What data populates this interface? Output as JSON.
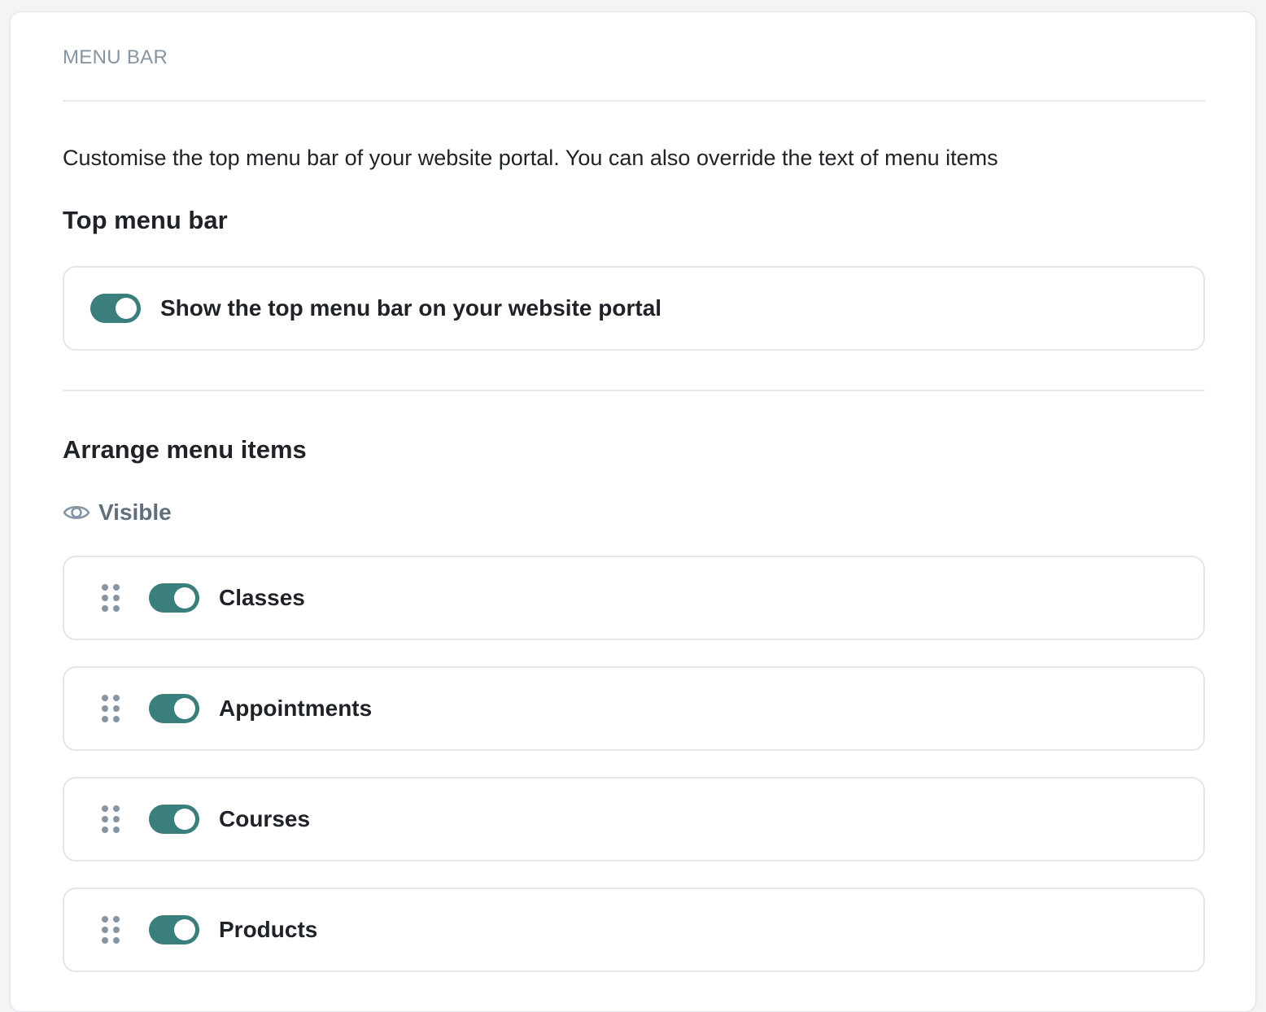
{
  "colors": {
    "accent": "#3a7f7b",
    "muted": "#8595a3",
    "visible_label": "#5f6f7c"
  },
  "section": {
    "label": "MENU BAR"
  },
  "description": "Customise the top menu bar of your website portal. You can also override the text of menu items",
  "top_menu_bar": {
    "heading": "Top menu bar",
    "toggle_label": "Show the top menu bar on your website portal",
    "toggle_on": true
  },
  "arrange": {
    "heading": "Arrange menu items",
    "visible_label": "Visible",
    "visible_icon": "eye-icon",
    "items": [
      {
        "label": "Classes",
        "enabled": true
      },
      {
        "label": "Appointments",
        "enabled": true
      },
      {
        "label": "Courses",
        "enabled": true
      },
      {
        "label": "Products",
        "enabled": true
      }
    ]
  }
}
